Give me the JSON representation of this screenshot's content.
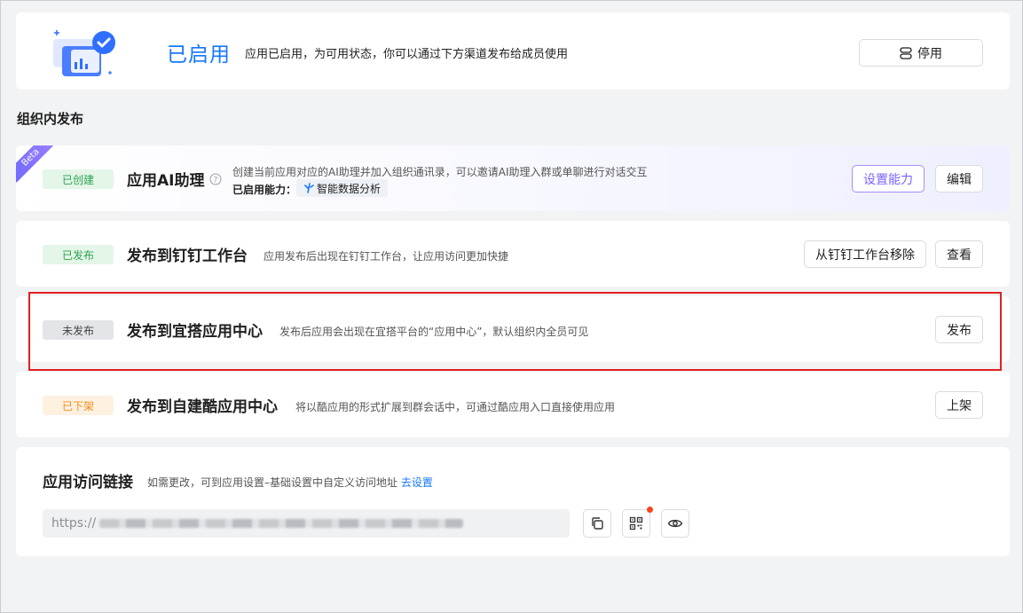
{
  "status": {
    "title": "已启用",
    "description": "应用已启用，为可用状态，你可以通过下方渠道发布给成员使用",
    "disable_label": "停用"
  },
  "section_heading": "组织内发布",
  "ai_row": {
    "beta_label": "Beta",
    "badge": "已创建",
    "title": "应用AI助理",
    "description": "创建当前应用对应的AI助理并加入组织通讯录，可以邀请AI助理入群或单聊进行对话交互",
    "caps_label": "已启用能力：",
    "cap_chip": "智能数据分析",
    "set_cap_label": "设置能力",
    "edit_label": "编辑"
  },
  "dingtalk_row": {
    "badge": "已发布",
    "title": "发布到钉钉工作台",
    "description": "应用发布后出现在钉钉工作台，让应用访问更加快捷",
    "remove_label": "从钉钉工作台移除",
    "view_label": "查看"
  },
  "yida_row": {
    "badge": "未发布",
    "title": "发布到宜搭应用中心",
    "description": "发布后应用会出现在宜搭平台的“应用中心”，默认组织内全员可见",
    "publish_label": "发布"
  },
  "cool_row": {
    "badge": "已下架",
    "title": "发布到自建酷应用中心",
    "description": "将以酷应用的形式扩展到群会话中，可通过酷应用入口直接使用应用",
    "list_label": "上架"
  },
  "access_link": {
    "title": "应用访问链接",
    "description": "如需更改，可到应用设置–基础设置中自定义访问地址",
    "go_settings": "去设置",
    "url_prefix": "https://"
  },
  "colors": {
    "accent": "#1677ff",
    "published": "#2ea34f",
    "unlisted": "#f08c1c",
    "highlight": "#e02020",
    "ai_button": "#7b61ff"
  },
  "icons": [
    "toggle-icon",
    "help-icon",
    "sparkle-icon",
    "copy-icon",
    "qrcode-icon",
    "eye-icon"
  ]
}
